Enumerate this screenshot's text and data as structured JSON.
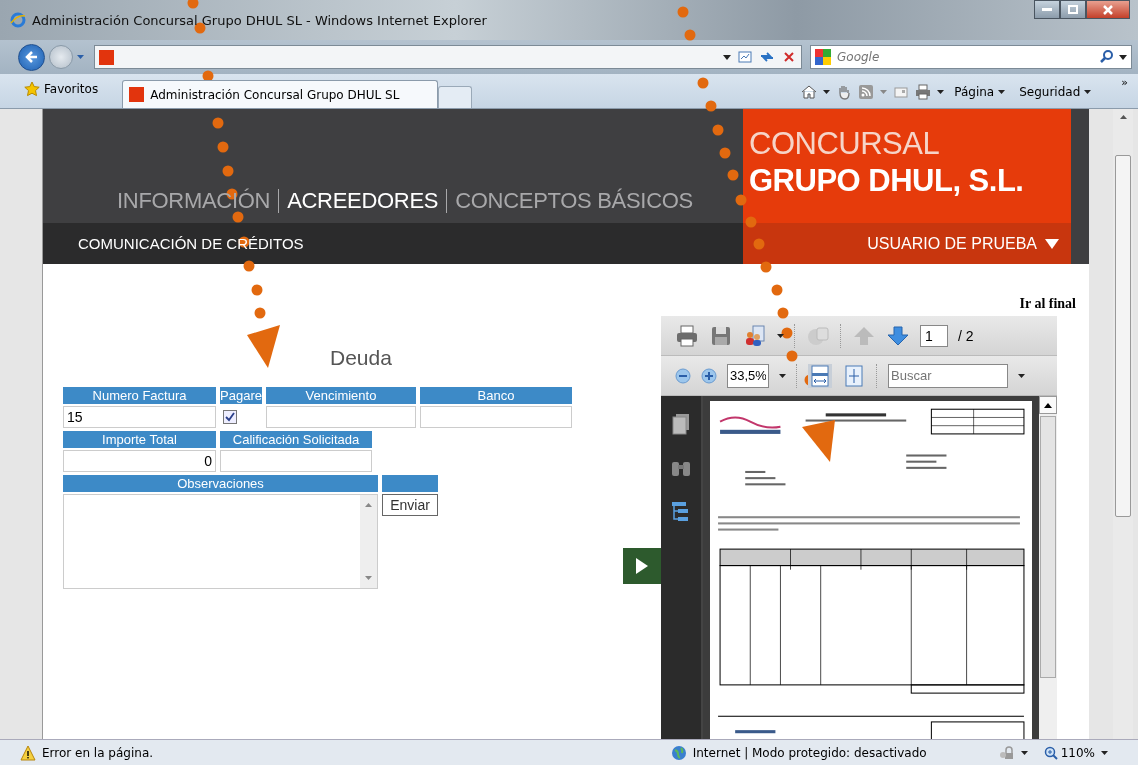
{
  "window": {
    "title": "Administración Concursal Grupo DHUL SL - Windows Internet Explorer"
  },
  "address_bar": {
    "search_placeholder": "Google"
  },
  "favorites": {
    "label": "Favoritos"
  },
  "tabs": [
    {
      "label": "Administración Concursal Grupo DHUL SL",
      "selected": true
    }
  ],
  "command_bar": {
    "menus": [
      "Página",
      "Seguridad"
    ],
    "overflow": "»"
  },
  "site": {
    "nav": [
      {
        "label": "INFORMACIÓN",
        "selected": false
      },
      {
        "label": "ACREEDORES",
        "selected": true
      },
      {
        "label": "CONCEPTOS BÁSICOS",
        "selected": false
      }
    ],
    "subnav": "COMUNICACIÓN DE CRÉDITOS",
    "brand": [
      "CONCURSAL",
      "GRUPO DHUL, S.L."
    ],
    "user": "USUARIO DE PRUEBA"
  },
  "form": {
    "title": "Deuda",
    "rows": [
      [
        {
          "kind": "text",
          "label": "Numero Factura",
          "value": "15"
        },
        {
          "kind": "checkbox",
          "label": "Pagare",
          "checked": true
        },
        {
          "kind": "text",
          "label": "Vencimiento"
        },
        {
          "kind": "text",
          "label": "Banco"
        }
      ],
      [
        {
          "kind": "number",
          "label": "Importe Total",
          "value": "0"
        },
        {
          "kind": "text",
          "label": "Calificación Solicitada"
        }
      ]
    ],
    "notes_label": "Observaciones",
    "submit": "Enviar"
  },
  "go_to_end": "Ir al final",
  "pdf_viewer": {
    "page": "1",
    "page_count": "/ 2",
    "zoom": "33,5%",
    "search_placeholder": "Buscar"
  },
  "status_bar": {
    "message": "Error en la página.",
    "zone": "Internet | Modo protegido: desactivado",
    "zoom": "110%"
  }
}
